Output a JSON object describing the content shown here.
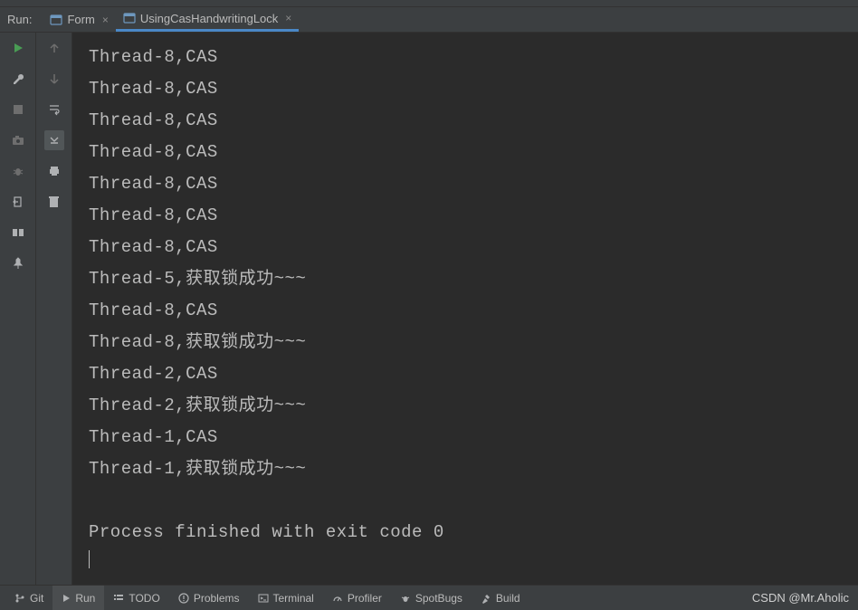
{
  "run_label": "Run:",
  "tabs": [
    {
      "label": "Form",
      "active": false
    },
    {
      "label": "UsingCasHandwritingLock",
      "active": true
    }
  ],
  "console_lines": [
    "Thread-8,CAS",
    "Thread-8,CAS",
    "Thread-8,CAS",
    "Thread-8,CAS",
    "Thread-8,CAS",
    "Thread-8,CAS",
    "Thread-8,CAS",
    "Thread-5,获取锁成功~~~",
    "Thread-8,CAS",
    "Thread-8,获取锁成功~~~",
    "Thread-2,CAS",
    "Thread-2,获取锁成功~~~",
    "Thread-1,CAS",
    "Thread-1,获取锁成功~~~",
    "",
    "Process finished with exit code 0"
  ],
  "bottom": {
    "git": "Git",
    "run": "Run",
    "todo": "TODO",
    "problems": "Problems",
    "terminal": "Terminal",
    "profiler": "Profiler",
    "spotbugs": "SpotBugs",
    "build": "Build"
  },
  "watermark": "CSDN @Mr.Aholic"
}
